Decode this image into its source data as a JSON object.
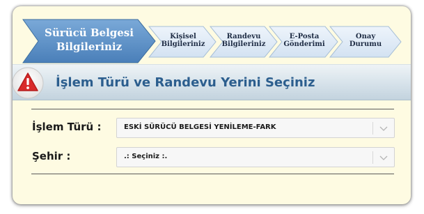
{
  "wizard": {
    "active_step": {
      "line1": "Sürücü Belgesi",
      "line2": "Bilgileriniz"
    },
    "steps": [
      {
        "line1": "Kişisel",
        "line2": "Bilgileriniz"
      },
      {
        "line1": "Randevu",
        "line2": "Bilgileriniz"
      },
      {
        "line1": "E-Posta",
        "line2": "Gönderimi"
      },
      {
        "line1": "Onay",
        "line2": "Durumu"
      }
    ]
  },
  "header": {
    "title": "İşlem Türü ve Randevu Yerini Seçiniz",
    "icon": "warning-icon"
  },
  "form": {
    "islem_turu": {
      "label": "İşlem Türü :",
      "value": "ESKİ SÜRÜCÜ BELGESİ YENİLEME-FARK"
    },
    "sehir": {
      "label": "Şehir :",
      "value": ".: Seçiniz :."
    }
  },
  "colors": {
    "panel_bg": "#fefbe2",
    "active_step": "#5a8fc6",
    "inactive_step": "#dce8f5",
    "title": "#2c5e8e",
    "warning": "#d92b2b"
  }
}
